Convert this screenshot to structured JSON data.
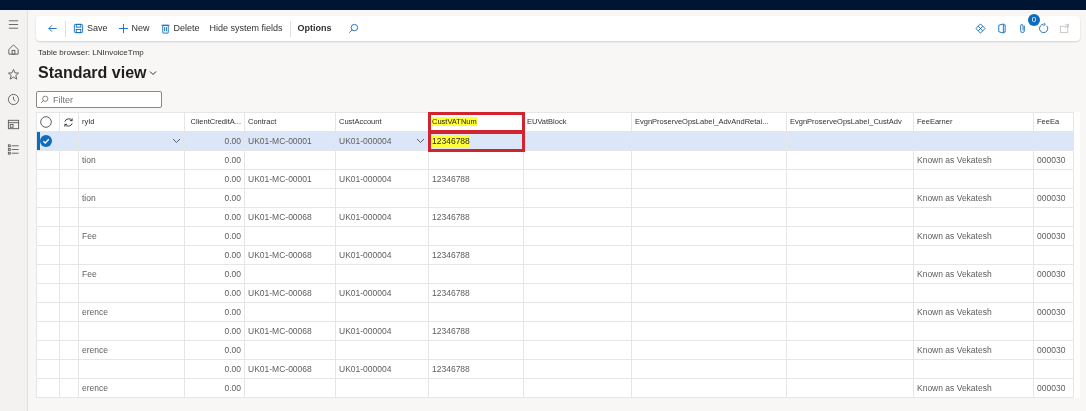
{
  "nav_rail": {
    "items": [
      {
        "kind": "menu"
      },
      {
        "kind": "home"
      },
      {
        "kind": "star"
      },
      {
        "kind": "clock"
      },
      {
        "kind": "workspace"
      },
      {
        "kind": "list"
      }
    ]
  },
  "toolbar": {
    "buttons": [
      {
        "kind": "back"
      },
      {
        "kind": "save",
        "label": "Save"
      },
      {
        "kind": "new",
        "label": "New"
      },
      {
        "kind": "delete",
        "label": "Delete"
      },
      {
        "kind": "text",
        "label": "Hide system fields"
      },
      {
        "kind": "bold",
        "label": "Options"
      },
      {
        "kind": "search"
      }
    ],
    "right_icons": [
      {
        "kind": "diamond"
      },
      {
        "kind": "office"
      },
      {
        "kind": "attach",
        "badge": "0"
      },
      {
        "kind": "refresh"
      },
      {
        "kind": "popout"
      }
    ]
  },
  "breadcrumb": "Table browser: LNInvoiceTmp",
  "view_title": "Standard view",
  "filter": {
    "placeholder": "Filter"
  },
  "grid": {
    "all_selected": false,
    "columns": [
      {
        "label": "ryId",
        "kind": "lookup"
      },
      {
        "label": "ClientCreditA...",
        "kind": "number"
      },
      {
        "label": "Contract",
        "kind": "text"
      },
      {
        "label": "CustAccount",
        "kind": "lookup"
      },
      {
        "label": "CustVATNum",
        "kind": "text",
        "highlighted": true,
        "framed": true
      },
      {
        "label": "EUVatBlock",
        "kind": "text"
      },
      {
        "label": "EvgnProserveOpsLabel_AdvAndRetai...",
        "kind": "text"
      },
      {
        "label": "EvgnProserveOpsLabel_CustAdv",
        "kind": "text"
      },
      {
        "label": "FeeEarner",
        "kind": "text"
      },
      {
        "label": "FeeEa",
        "kind": "text"
      }
    ],
    "rows": [
      {
        "selected": true,
        "c2": "0.00",
        "c3": "UK01-MC-00001",
        "c4": "UK01-000004",
        "c5": "12346788"
      },
      {
        "selected": false,
        "c1": "tion",
        "c2": "0.00",
        "c9": "Known as Vekatesh",
        "c10": "000030"
      },
      {
        "selected": false,
        "c2": "0.00",
        "c3": "UK01-MC-00001",
        "c4": "UK01-000004",
        "c5": "12346788"
      },
      {
        "selected": false,
        "c1": "tion",
        "c2": "0.00",
        "c9": "Known as Vekatesh",
        "c10": "000030"
      },
      {
        "selected": false,
        "c2": "0.00",
        "c3": "UK01-MC-00068",
        "c4": "UK01-000004",
        "c5": "12346788"
      },
      {
        "selected": false,
        "c1": "Fee",
        "c2": "0.00",
        "c9": "Known as Vekatesh",
        "c10": "000030"
      },
      {
        "selected": false,
        "c2": "0.00",
        "c3": "UK01-MC-00068",
        "c4": "UK01-000004",
        "c5": "12346788"
      },
      {
        "selected": false,
        "c1": "Fee",
        "c2": "0.00",
        "c9": "Known as Vekatesh",
        "c10": "000030"
      },
      {
        "selected": false,
        "c2": "0.00",
        "c3": "UK01-MC-00068",
        "c4": "UK01-000004",
        "c5": "12346788"
      },
      {
        "selected": false,
        "c1": "erence",
        "c2": "0.00",
        "c9": "Known as Vekatesh",
        "c10": "000030"
      },
      {
        "selected": false,
        "c2": "0.00",
        "c3": "UK01-MC-00068",
        "c4": "UK01-000004",
        "c5": "12346788"
      },
      {
        "selected": false,
        "c1": "erence",
        "c2": "0.00",
        "c9": "Known as Vekatesh",
        "c10": "000030"
      },
      {
        "selected": false,
        "c2": "0.00",
        "c3": "UK01-MC-00068",
        "c4": "UK01-000004",
        "c5": "12346788"
      },
      {
        "selected": false,
        "c1": "erence",
        "c2": "0.00",
        "c9": "Known as Vekatesh",
        "c10": "000030"
      }
    ]
  }
}
